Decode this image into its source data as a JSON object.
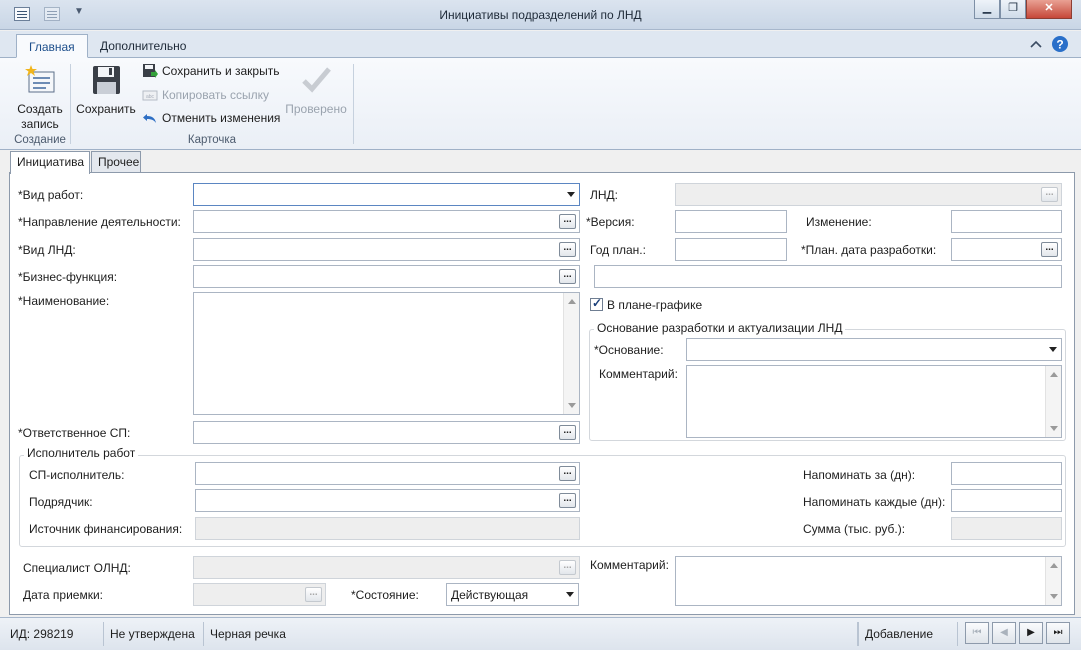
{
  "window": {
    "title": "Инициативы подразделений по ЛНД",
    "minimize": "▁",
    "maximize": "❐",
    "close": "✕"
  },
  "ribbon": {
    "tabs": [
      "Главная",
      "Дополнительно"
    ],
    "groups": {
      "create": {
        "label": "Создание",
        "create_record": "Создать запись"
      },
      "card": {
        "label": "Карточка",
        "save": "Сохранить",
        "save_close": "Сохранить и закрыть",
        "copy_link": "Копировать ссылку",
        "undo": "Отменить изменения",
        "checked": "Проверено"
      }
    }
  },
  "page_tabs": [
    "Инициатива",
    "Прочее"
  ],
  "form": {
    "vid_rabot": {
      "label": "*Вид работ:",
      "value": ""
    },
    "napravlenie": {
      "label": "*Направление деятельности:",
      "value": ""
    },
    "vid_lnd": {
      "label": "*Вид ЛНД:",
      "value": ""
    },
    "biznes_funkciya": {
      "label": "*Бизнес-функция:",
      "value": ""
    },
    "naimenovanie": {
      "label": "*Наименование:",
      "value": ""
    },
    "otvetstvennoe_sp": {
      "label": "*Ответственное СП:",
      "value": ""
    },
    "lnd": {
      "label": "ЛНД:",
      "value": ""
    },
    "versiya": {
      "label": "*Версия:",
      "value": ""
    },
    "izmenenie": {
      "label": "Изменение:",
      "value": ""
    },
    "god_plan": {
      "label": "Год план.:",
      "value": ""
    },
    "plan_data": {
      "label": "*План. дата разработки:",
      "value": ""
    },
    "v_plane": {
      "label": "В плане-графике",
      "checked": true
    },
    "osnovanie_group": {
      "title": "Основание разработки и актуализации ЛНД",
      "osnovanie_label": "*Основание:",
      "osnovanie_value": "",
      "comment_label": "Комментарий:",
      "comment_value": ""
    },
    "ispolnitel_group": {
      "title": "Исполнитель работ",
      "sp_label": "СП-исполнитель:",
      "podryadchik_label": "Подрядчик:",
      "istochnik_label": "Источник финансирования:",
      "napominat_za_label": "Напоминать за (дн):",
      "napominat_kazhdye_label": "Напоминать каждые (дн):",
      "summa_label": "Сумма (тыс. руб.):"
    },
    "specialist_label": "Специалист ОЛНД:",
    "data_priemki_label": "Дата приемки:",
    "sostoyanie_label": "*Состояние:",
    "sostoyanie_value": "Действующая",
    "comment_bottom_label": "Комментарий:"
  },
  "statusbar": {
    "id": "ИД: 298219",
    "status": "Не утверждена",
    "org": "Черная речка",
    "mode": "Добавление",
    "nav_first": "⏮",
    "nav_prev": "◀",
    "nav_next": "▶",
    "nav_last": "⏭"
  }
}
